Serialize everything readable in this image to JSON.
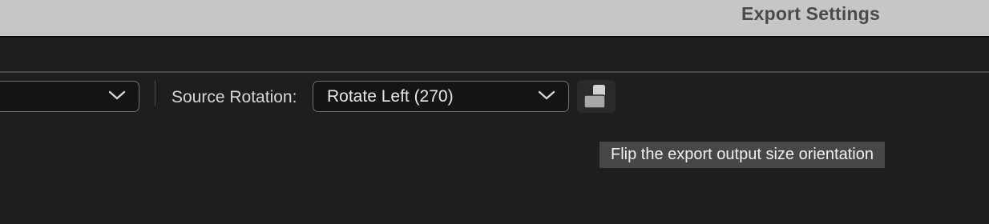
{
  "window": {
    "title": "Export Settings"
  },
  "toolbar": {
    "left_dropdown_value": "",
    "source_rotation_label": "Source Rotation:",
    "source_rotation_value": "Rotate Left (270)",
    "flip_button_icon": "flip-orientation-icon",
    "chevron_icon": "chevron-down-icon"
  },
  "tooltip": {
    "text": "Flip the export output size orientation"
  },
  "colors": {
    "titlebar_bg": "#c6c6c6",
    "panel_bg": "#1e1e1e",
    "dropdown_bg": "#141414",
    "tooltip_bg": "#474747"
  }
}
